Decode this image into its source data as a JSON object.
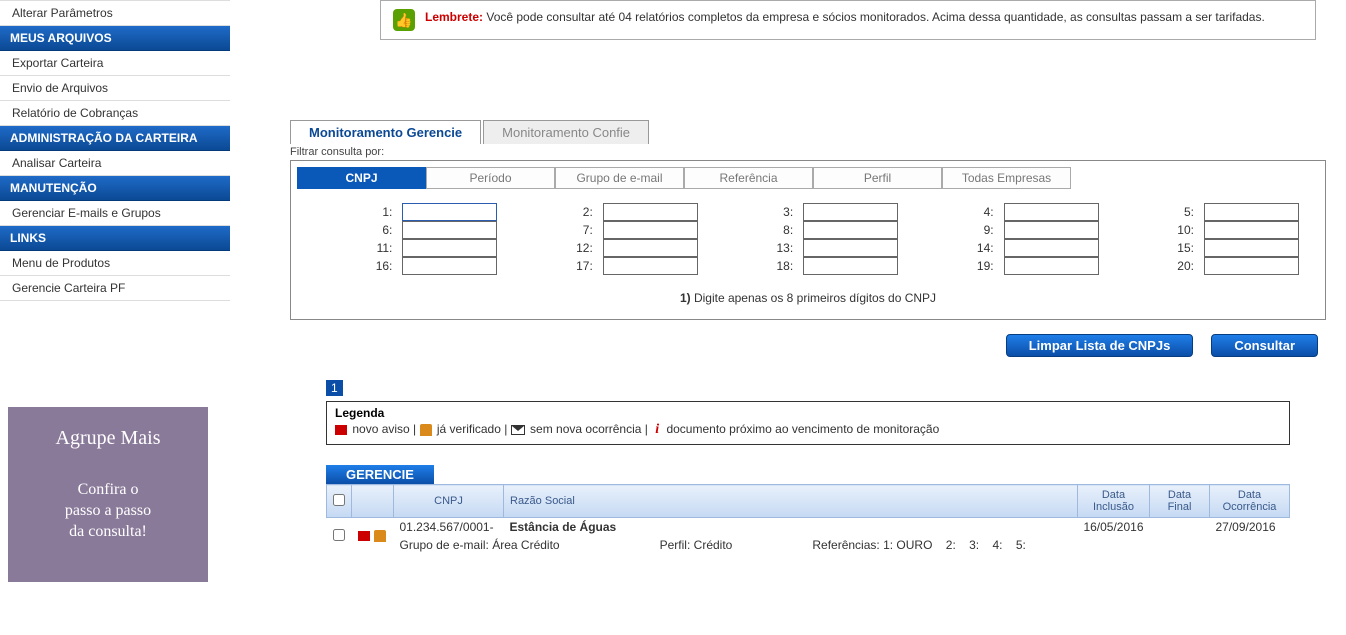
{
  "sidebar": {
    "items0": [
      "Alterar Parâmetros"
    ],
    "head1": "MEUS ARQUIVOS",
    "items1": [
      "Exportar Carteira",
      "Envio de Arquivos",
      "Relatório de Cobranças"
    ],
    "head2": "ADMINISTRAÇÃO DA CARTEIRA",
    "items2": [
      "Analisar Carteira"
    ],
    "head3": "MANUTENÇÃO",
    "items3": [
      "Gerenciar E-mails e Grupos"
    ],
    "head4": "LINKS",
    "items4": [
      "Menu de Produtos",
      "Gerencie Carteira PF"
    ]
  },
  "promo": {
    "title": "Agrupe Mais",
    "l1": "Confira o",
    "l2": "passo a passo",
    "l3": "da consulta!"
  },
  "reminder": {
    "label": "Lembrete:",
    "text": "Você pode consultar até 04 relatórios completos da empresa e sócios monitorados. Acima dessa quantidade, as consultas passam a ser tarifadas."
  },
  "topTabs": {
    "a": "Monitoramento Gerencie",
    "b": "Monitoramento Confie"
  },
  "filterLabel": "Filtrar consulta por:",
  "ftabs": [
    "CNPJ",
    "Período",
    "Grupo de e-mail",
    "Referência",
    "Perfil",
    "Todas Empresas"
  ],
  "cnpjLabels": [
    "1:",
    "2:",
    "3:",
    "4:",
    "5:",
    "6:",
    "7:",
    "8:",
    "9:",
    "10:",
    "11:",
    "12:",
    "13:",
    "14:",
    "15:",
    "16:",
    "17:",
    "18:",
    "19:",
    "20:"
  ],
  "hint": {
    "b": "1)",
    "t": " Digite apenas os 8 primeiros dígitos do CNPJ"
  },
  "btn": {
    "clear": "Limpar Lista de CNPJs",
    "go": "Consultar"
  },
  "pager": "1",
  "legend": {
    "title": "Legenda",
    "a": "novo aviso",
    "b": "já verificado",
    "c": "sem nova ocorrência",
    "d": "documento próximo ao vencimento de monitoração"
  },
  "tableTitle": "GERENCIE",
  "thead": {
    "cnpj": "CNPJ",
    "razao": "Razão Social",
    "di": "Data Inclusão",
    "df": "Data Final",
    "do": "Data Ocorrência"
  },
  "row": {
    "cnpj": "01.234.567/0001-",
    "razao": "Estância de Águas",
    "di": "16/05/2016",
    "df": "",
    "do": "27/09/2016",
    "grp_k": "Grupo de e-mail:",
    "grp_v": "Área Crédito",
    "perfil_k": "Perfil:",
    "perfil_v": "Crédito",
    "ref_k": "Referências:",
    "refs": [
      "1: OURO",
      "2:",
      "3:",
      "4:",
      "5:"
    ]
  }
}
